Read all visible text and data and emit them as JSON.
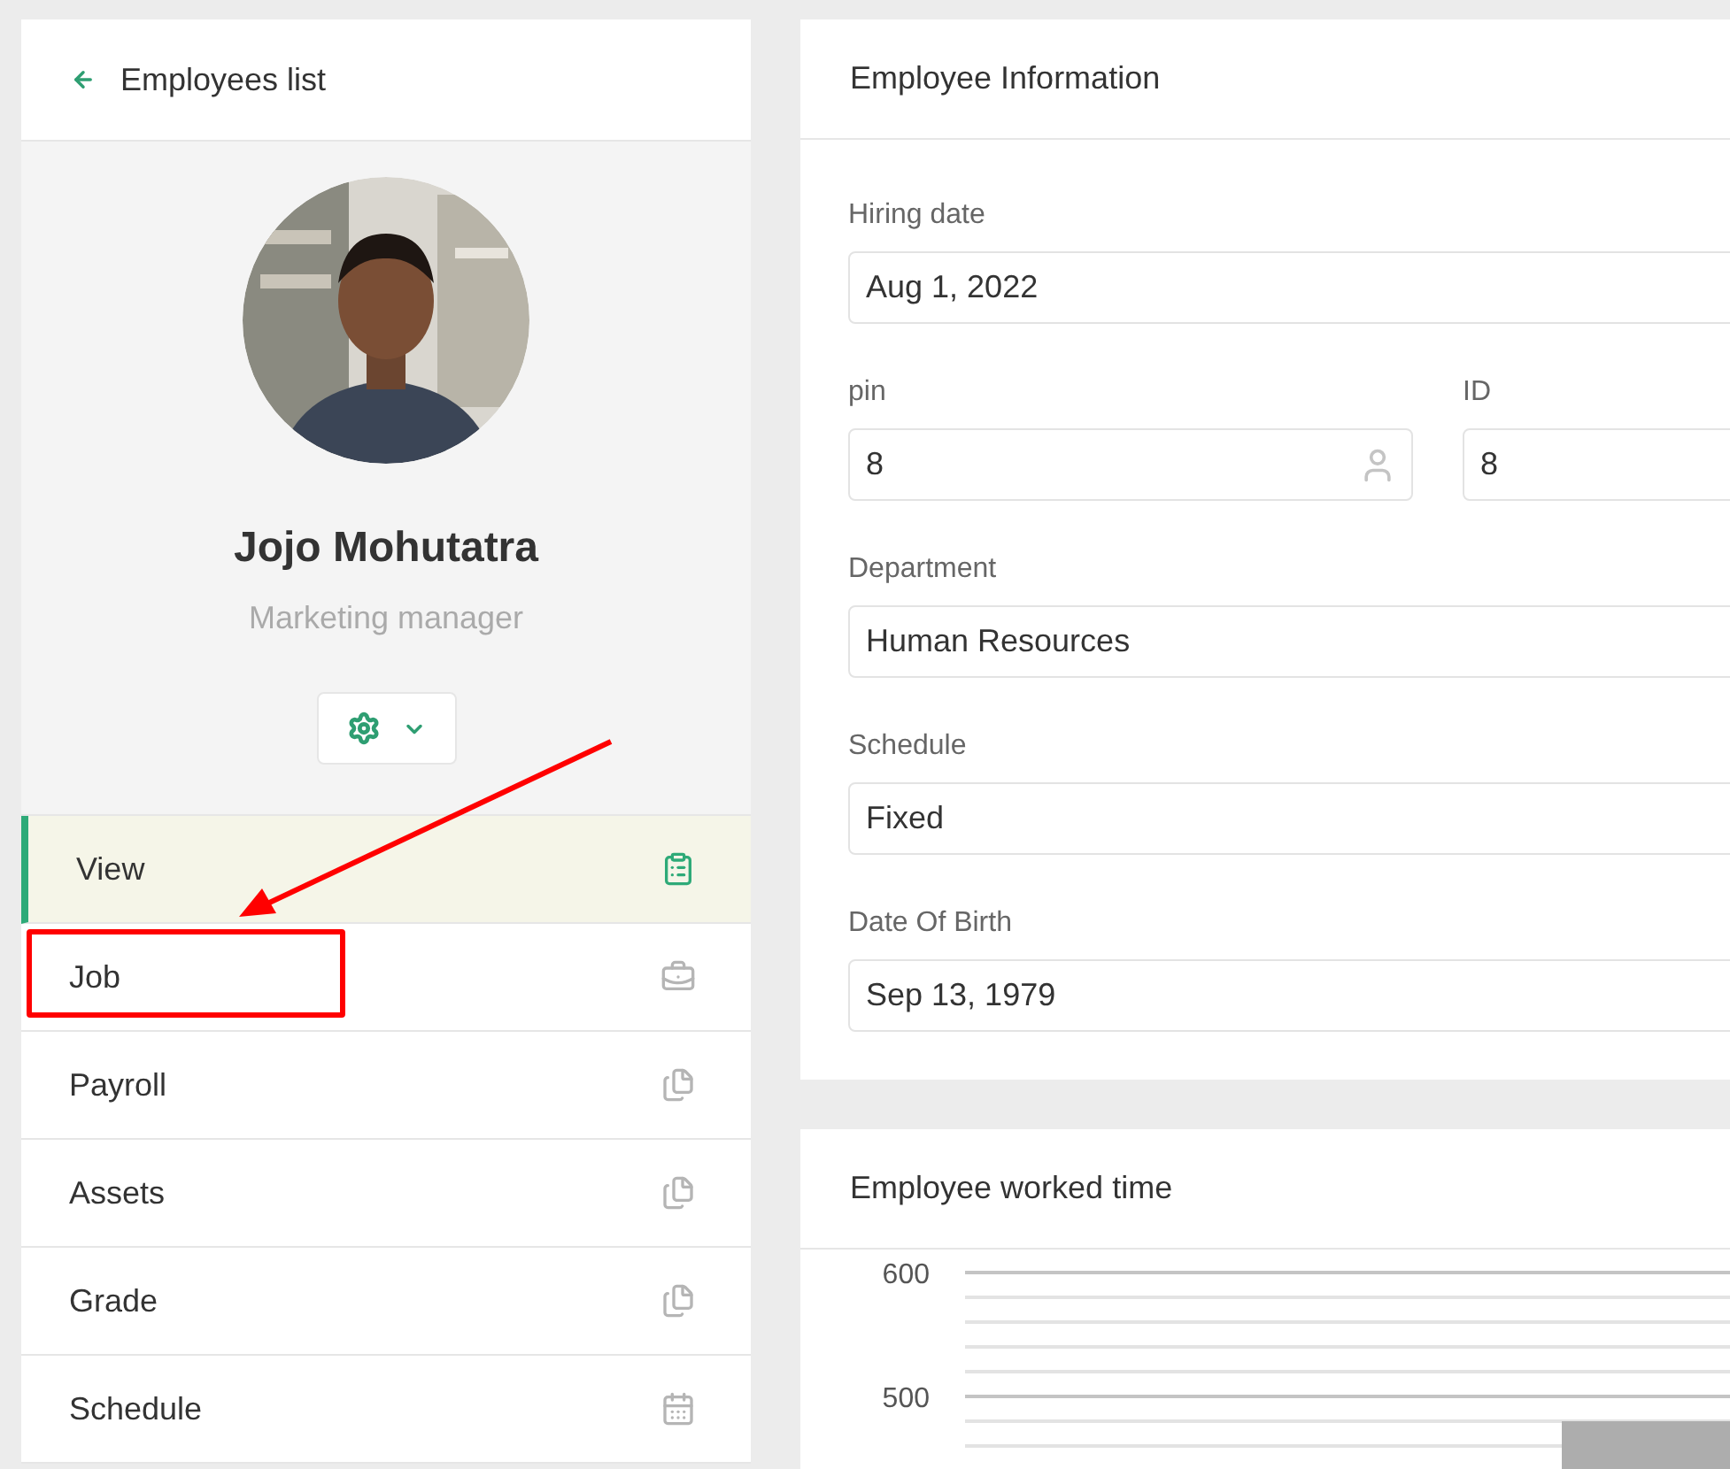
{
  "back_link": {
    "label": "Employees list"
  },
  "profile": {
    "name": "Jojo Mohutatra",
    "role": "Marketing manager"
  },
  "menu": [
    {
      "label": "View",
      "selected": true
    },
    {
      "label": "Job",
      "selected": false
    },
    {
      "label": "Payroll",
      "selected": false
    },
    {
      "label": "Assets",
      "selected": false
    },
    {
      "label": "Grade",
      "selected": false
    },
    {
      "label": "Schedule",
      "selected": false
    }
  ],
  "employee_information": {
    "title": "Employee Information",
    "rows": [
      [
        {
          "label": "Hiring date",
          "value": "Aug 1, 2022",
          "kind": "plain"
        }
      ],
      [
        {
          "label": "pin",
          "value": "8",
          "kind": "user"
        },
        {
          "label": "ID",
          "value": "8",
          "kind": "plain"
        }
      ],
      [
        {
          "label": "Department",
          "value": "Human Resources",
          "kind": "plain"
        }
      ],
      [
        {
          "label": "Schedule",
          "value": "Fixed",
          "kind": "plain"
        }
      ],
      [
        {
          "label": "Date Of Birth",
          "value": "Sep 13, 1979",
          "kind": "plain"
        }
      ]
    ]
  },
  "worked_time": {
    "title": "Employee worked time",
    "chart_data": {
      "type": "bar",
      "values": [
        480
      ],
      "ylim": [
        440,
        600
      ],
      "yticks": [
        500,
        600
      ]
    }
  }
}
